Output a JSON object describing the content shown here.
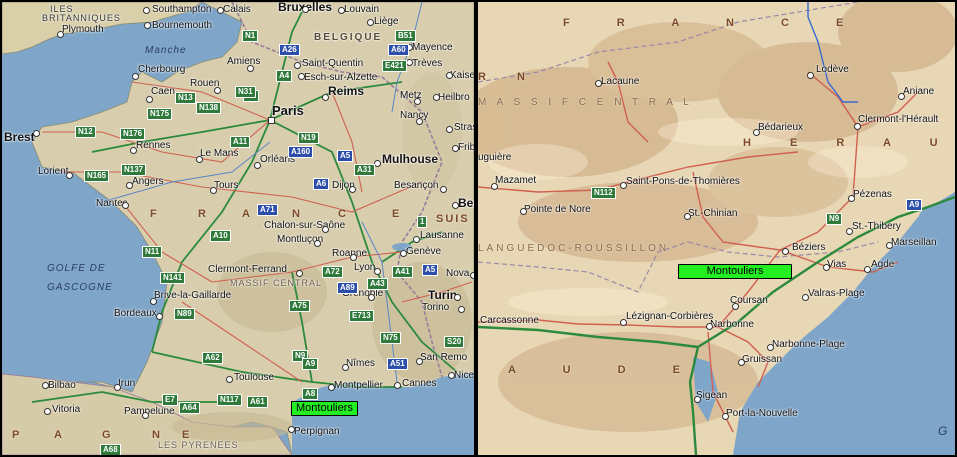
{
  "left_map": {
    "sea_labels": [
      "Manche",
      "GOLFE DE",
      "GASCOGNE"
    ],
    "country_labels": [
      "ILES",
      "BRITANNIQUES",
      "BELGIQUE",
      "F",
      "R",
      "A",
      "N",
      "C",
      "E",
      "SUIS",
      "P",
      "A",
      "G",
      "N",
      "E"
    ],
    "mountain_labels": [
      "MASSIF CENTRAL",
      "LES PYRENEES"
    ],
    "cities": [
      {
        "name": "Southampton"
      },
      {
        "name": "Calais"
      },
      {
        "name": "Bruxelles"
      },
      {
        "name": "Louvain"
      },
      {
        "name": "Plymouth"
      },
      {
        "name": "Bournemouth"
      },
      {
        "name": "Liège"
      },
      {
        "name": "Mayence"
      },
      {
        "name": "Trèves"
      },
      {
        "name": "Saint-Quentin"
      },
      {
        "name": "Esch-sur-Alzette"
      },
      {
        "name": "Amiens"
      },
      {
        "name": "Kaise"
      },
      {
        "name": "Heilbro"
      },
      {
        "name": "Cherbourg"
      },
      {
        "name": "Rouen"
      },
      {
        "name": "Reims"
      },
      {
        "name": "Metz"
      },
      {
        "name": "Caen"
      },
      {
        "name": "Paris"
      },
      {
        "name": "Nancy"
      },
      {
        "name": "Stras"
      },
      {
        "name": "Brest"
      },
      {
        "name": "Rennes"
      },
      {
        "name": "Le Mans"
      },
      {
        "name": "Orléans"
      },
      {
        "name": "Mulhouse"
      },
      {
        "name": "Frib"
      },
      {
        "name": "Lorient"
      },
      {
        "name": "Angers"
      },
      {
        "name": "Tours"
      },
      {
        "name": "Dijon"
      },
      {
        "name": "Besançon"
      },
      {
        "name": "Berne"
      },
      {
        "name": "Nantes"
      },
      {
        "name": "Chalon-sur-Saône"
      },
      {
        "name": "Lausanne"
      },
      {
        "name": "Montluçon"
      },
      {
        "name": "Genève"
      },
      {
        "name": "Roanne"
      },
      {
        "name": "Clermont-Ferrand"
      },
      {
        "name": "Lyon"
      },
      {
        "name": "Nova"
      },
      {
        "name": "Brive-la-Gaillarde"
      },
      {
        "name": "Grenoble"
      },
      {
        "name": "Turin"
      },
      {
        "name": "Torino"
      },
      {
        "name": "Bordeaux"
      },
      {
        "name": "San Remo"
      },
      {
        "name": "Nîmes"
      },
      {
        "name": "Toulouse"
      },
      {
        "name": "Montpellier"
      },
      {
        "name": "Cannes"
      },
      {
        "name": "Nice"
      },
      {
        "name": "Bilbao"
      },
      {
        "name": "Irun"
      },
      {
        "name": "Vitoria"
      },
      {
        "name": "Pampelune"
      },
      {
        "name": "Perpignan"
      }
    ],
    "road_shields": [
      "N1",
      "A26",
      "B51",
      "A60",
      "E421",
      "A1",
      "A4",
      "N31",
      "N13",
      "N138",
      "N175",
      "N12",
      "N176",
      "A11",
      "A160",
      "N19",
      "A5",
      "A31",
      "N137",
      "N165",
      "A6",
      "A71",
      "A10",
      "N11",
      "N141",
      "A72",
      "A41",
      "A43",
      "A89",
      "E713",
      "A75",
      "N75",
      "N89",
      "A62",
      "A51",
      "N9",
      "S20",
      "A8",
      "E7",
      "A64",
      "N117",
      "A61",
      "A68",
      "A9",
      "1",
      "A5"
    ],
    "marker_label": "Montouliers"
  },
  "right_map": {
    "region_labels": [
      "F R A N C E",
      "H E R A U L T",
      "A U D E",
      "LANGUEDOC-ROUSSILLON",
      "M A S S I F   C E N T R A L",
      "R N"
    ],
    "cities": [
      {
        "name": "Lacaune"
      },
      {
        "name": "Lodève"
      },
      {
        "name": "Aniane"
      },
      {
        "name": "Bédarieux"
      },
      {
        "name": "Clermont-l'Hérault"
      },
      {
        "name": "uguière"
      },
      {
        "name": "Mazamet"
      },
      {
        "name": "Saint-Pons-de-Thomières"
      },
      {
        "name": "Pézenas"
      },
      {
        "name": "Pointe de Nore"
      },
      {
        "name": "St.-Chinian"
      },
      {
        "name": "St.-Thibery"
      },
      {
        "name": "Marseillan"
      },
      {
        "name": "Béziers"
      },
      {
        "name": "Vias"
      },
      {
        "name": "Agde"
      },
      {
        "name": "Valras-Plage"
      },
      {
        "name": "Coursan"
      },
      {
        "name": "Carcassonne"
      },
      {
        "name": "Lézignan-Corbières"
      },
      {
        "name": "Narbonne"
      },
      {
        "name": "Narbonne-Plage"
      },
      {
        "name": "Gruissan"
      },
      {
        "name": "Sigean"
      },
      {
        "name": "Port-la-Nouvelle"
      }
    ],
    "road_shields": [
      "N112",
      "N9",
      "A9"
    ],
    "corner_letter": "G",
    "marker_label": "Montouliers"
  },
  "colors": {
    "marker": "#22ee22",
    "sea": "#7fa6c9",
    "land_left": "#d8ceae",
    "land_right": "#e8d7b4",
    "motorway": "#2c8a3c",
    "road": "#d06050",
    "border": "#9a7a9a"
  }
}
